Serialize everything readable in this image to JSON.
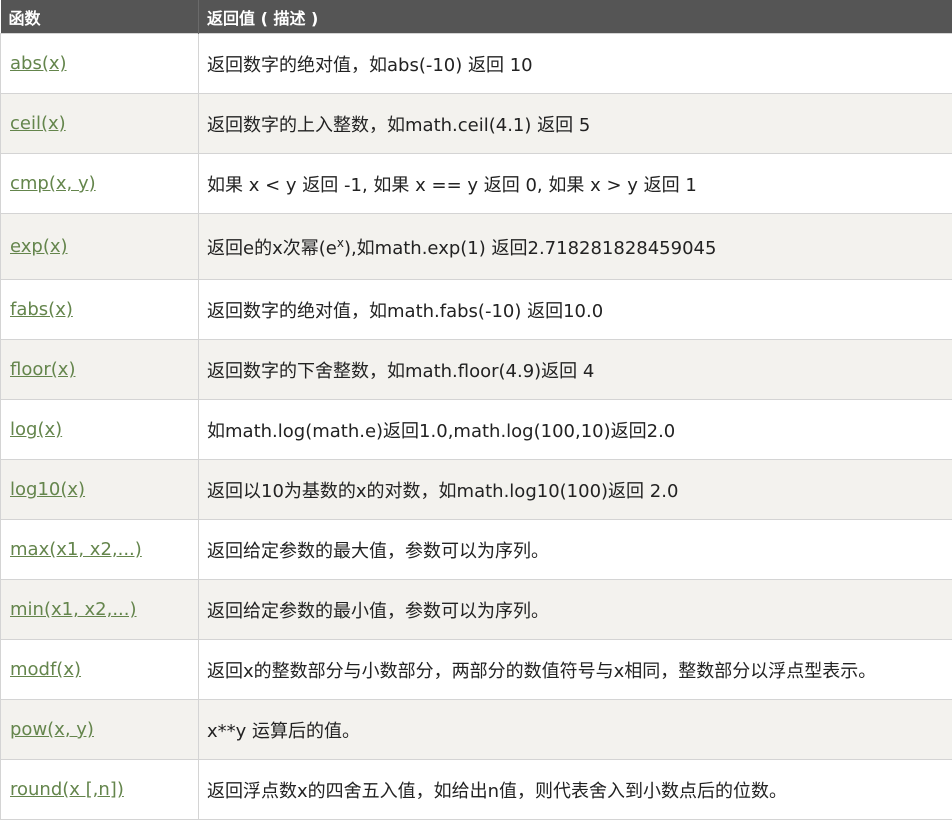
{
  "header": {
    "col_function": "函数",
    "col_description": "返回值 ( 描述 )"
  },
  "rows": [
    {
      "fn": "abs(x)",
      "desc": "返回数字的绝对值，如abs(-10) 返回 10"
    },
    {
      "fn": "ceil(x)",
      "desc": "返回数字的上入整数，如math.ceil(4.1) 返回 5"
    },
    {
      "fn": "cmp(x, y)",
      "desc": "如果 x < y 返回 -1, 如果 x == y 返回 0, 如果 x > y 返回 1"
    },
    {
      "fn": "exp(x)",
      "desc_before": "返回e的x次幂(e",
      "desc_sup": "x",
      "desc_after": "),如math.exp(1) 返回2.718281828459045"
    },
    {
      "fn": "fabs(x)",
      "desc": "返回数字的绝对值，如math.fabs(-10) 返回10.0"
    },
    {
      "fn": "floor(x)",
      "desc": "返回数字的下舍整数，如math.floor(4.9)返回 4"
    },
    {
      "fn": "log(x)",
      "desc": "如math.log(math.e)返回1.0,math.log(100,10)返回2.0"
    },
    {
      "fn": "log10(x)",
      "desc": "返回以10为基数的x的对数，如math.log10(100)返回 2.0"
    },
    {
      "fn": "max(x1, x2,...)",
      "desc": "返回给定参数的最大值，参数可以为序列。"
    },
    {
      "fn": "min(x1, x2,...)",
      "desc": "返回给定参数的最小值，参数可以为序列。"
    },
    {
      "fn": "modf(x)",
      "desc": "返回x的整数部分与小数部分，两部分的数值符号与x相同，整数部分以浮点型表示。"
    },
    {
      "fn": "pow(x, y)",
      "desc": "x**y 运算后的值。"
    },
    {
      "fn": "round(x [,n])",
      "desc": "返回浮点数x的四舍五入值，如给出n值，则代表舍入到小数点后的位数。"
    }
  ]
}
